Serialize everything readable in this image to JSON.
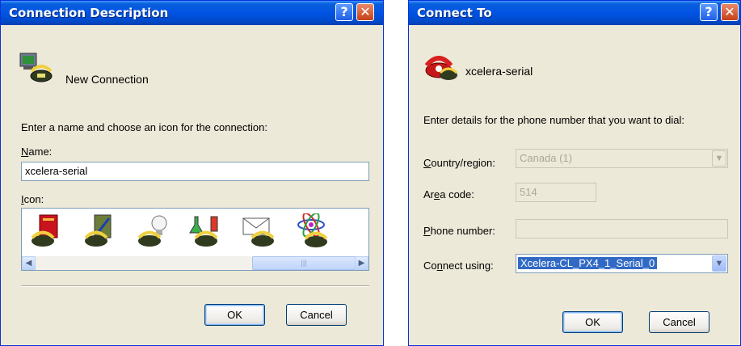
{
  "dialog1": {
    "title": "Connection Description",
    "help_glyph": "?",
    "close_glyph": "✕",
    "header_text": "New Connection",
    "instruction": "Enter a name and choose an icon for the connection:",
    "name_label_mnemonic": "N",
    "name_label_rest": "ame:",
    "name_value": "xcelera-serial",
    "icon_label_mnemonic": "I",
    "icon_label_rest": "con:",
    "icons": [
      "book-phone-icon",
      "clipboard-phone-icon",
      "lightbulb-phone-icon",
      "lab-flask-phone-icon",
      "envelope-phone-icon",
      "atom-phone-icon"
    ],
    "scroll_left": "◀",
    "scroll_right": "▶",
    "scroll_thumb": "|||",
    "ok_label": "OK",
    "cancel_label": "Cancel"
  },
  "dialog2": {
    "title": "Connect To",
    "help_glyph": "?",
    "close_glyph": "✕",
    "header_text": "xcelera-serial",
    "instruction": "Enter details for the phone number that you want to dial:",
    "country_label_mnemonic": "C",
    "country_label_rest": "ountry/region:",
    "country_value": "Canada (1)",
    "area_label_pre": "Ar",
    "area_label_mnemonic": "e",
    "area_label_rest": "a code:",
    "area_value": "514",
    "phone_label_mnemonic": "P",
    "phone_label_rest": "hone number:",
    "phone_value": "",
    "connect_label_pre": "Co",
    "connect_label_mnemonic": "n",
    "connect_label_rest": "nect using:",
    "connect_value": "Xcelera-CL_PX4_1_Serial_0",
    "dropdown_glyph": "▼",
    "ok_label": "OK",
    "cancel_label": "Cancel"
  },
  "colors": {
    "titlebar": "#0054e3",
    "dialog_bg": "#ece9d8",
    "selection": "#316ac5",
    "close_button": "#c64018"
  }
}
